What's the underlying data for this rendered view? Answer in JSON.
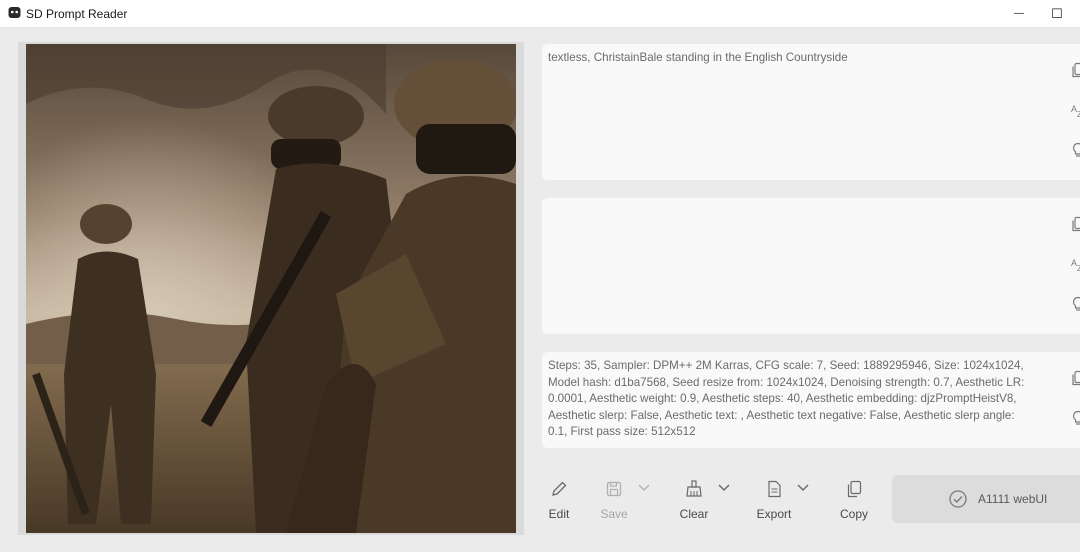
{
  "window": {
    "title": "SD Prompt Reader",
    "minimize_glyph": "—",
    "maximize_glyph": "☐"
  },
  "prompt": {
    "positive_text": "textless, ChristainBale standing in the English Countryside",
    "negative_text": "",
    "settings_text": "Steps: 35, Sampler: DPM++ 2M Karras, CFG scale: 7, Seed: 1889295946, Size: 1024x1024, Model hash: d1ba7568, Seed resize from: 1024x1024, Denoising strength: 0.7, Aesthetic LR: 0.0001, Aesthetic weight: 0.9, Aesthetic steps: 40, Aesthetic embedding: djzPromptHeistV8, Aesthetic slerp: False, Aesthetic text: , Aesthetic text negative: False, Aesthetic slerp angle: 0.1, First pass size: 512x512"
  },
  "toolbar": {
    "edit_label": "Edit",
    "save_label": "Save",
    "clear_label": "Clear",
    "export_label": "Export",
    "copy_label": "Copy",
    "format_label": "A1111 webUI"
  },
  "icons": {
    "copy": "copy-icon",
    "sort": "sort-icon",
    "hint": "lightbulb-icon",
    "edit": "pencil-icon",
    "save": "floppy-icon",
    "clear": "broom-icon",
    "export": "document-icon",
    "check": "check-circle-icon"
  },
  "colors": {
    "background": "#ebebeb",
    "panel": "#f9f9f9",
    "disabled_button": "#dcdcdc",
    "text": "#6b6b6b"
  }
}
